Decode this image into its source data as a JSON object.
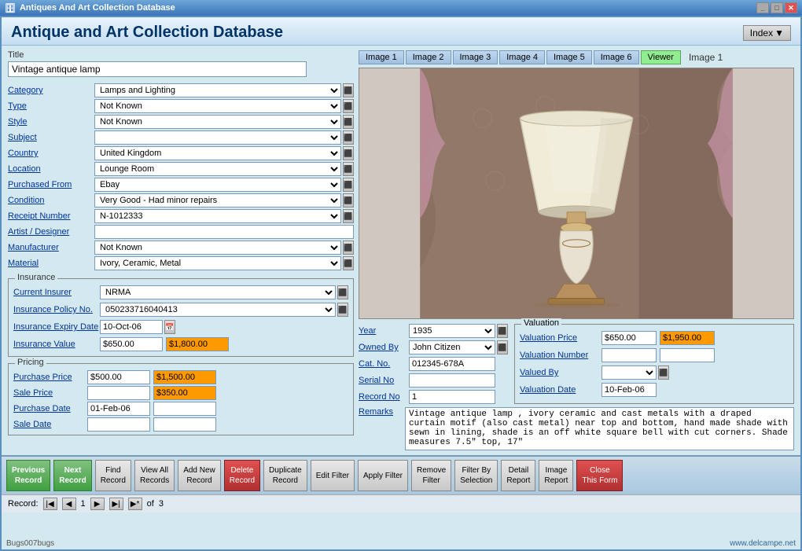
{
  "window": {
    "title": "Antiques And Art Collection Database",
    "app_title": "Antique and Art Collection Database"
  },
  "header": {
    "index_label": "Index",
    "image_label": "Image 1"
  },
  "image_tabs": [
    {
      "id": "img1",
      "label": "Image 1"
    },
    {
      "id": "img2",
      "label": "Image 2"
    },
    {
      "id": "img3",
      "label": "Image 3"
    },
    {
      "id": "img4",
      "label": "Image 4"
    },
    {
      "id": "img5",
      "label": "Image 5"
    },
    {
      "id": "img6",
      "label": "Image 6"
    },
    {
      "id": "viewer",
      "label": "Viewer"
    }
  ],
  "form": {
    "title_label": "Title",
    "title_value": "Vintage antique lamp",
    "fields": [
      {
        "label": "Category",
        "value": "Lamps and Lighting",
        "type": "select"
      },
      {
        "label": "Type",
        "value": "Not Known",
        "type": "select"
      },
      {
        "label": "Style",
        "value": "Not Known",
        "type": "select"
      },
      {
        "label": "Subject",
        "value": "",
        "type": "select"
      },
      {
        "label": "Country",
        "value": "United Kingdom",
        "type": "select"
      },
      {
        "label": "Location",
        "value": "Lounge Room",
        "type": "select"
      },
      {
        "label": "Purchased From",
        "value": "Ebay",
        "type": "select"
      },
      {
        "label": "Condition",
        "value": "Very Good - Had minor repairs",
        "type": "select"
      },
      {
        "label": "Receipt Number",
        "value": "N-1012333",
        "type": "select"
      },
      {
        "label": "Artist / Designer",
        "value": "",
        "type": "text"
      },
      {
        "label": "Manufacturer",
        "value": "Not Known",
        "type": "select"
      },
      {
        "label": "Material",
        "value": "Ivory, Ceramic, Metal",
        "type": "select"
      }
    ]
  },
  "insurance": {
    "section_label": "Insurance",
    "fields": [
      {
        "label": "Current Insurer",
        "value": "NRMA",
        "type": "select"
      },
      {
        "label": "Insurance Policy No.",
        "value": "050233716040413",
        "type": "select"
      },
      {
        "label": "Insurance Expiry Date",
        "value": "10-Oct-06",
        "type": "date"
      },
      {
        "label": "Insurance Value",
        "value1": "$650.00",
        "value2": "$1,800.00",
        "value2_style": "orange"
      }
    ]
  },
  "pricing": {
    "section_label": "Pricing",
    "fields": [
      {
        "label": "Purchase Price",
        "value1": "$500.00",
        "value2": "$1,500.00",
        "value2_style": "orange"
      },
      {
        "label": "Sale Price",
        "value1": "",
        "value2": "$350.00",
        "value2_style": "orange"
      },
      {
        "label": "Purchase Date",
        "value1": "01-Feb-06",
        "value2": ""
      },
      {
        "label": "Sale Date",
        "value1": "",
        "value2": ""
      }
    ]
  },
  "middle_fields": {
    "year_label": "Year",
    "year_value": "1935",
    "owned_by_label": "Owned By",
    "owned_by_value": "John Citizen",
    "cat_no_label": "Cat. No.",
    "cat_no_value": "012345-678A",
    "serial_no_label": "Serial No",
    "serial_no_value": "",
    "record_no_label": "Record No",
    "record_no_value": "1"
  },
  "valuation": {
    "section_label": "Valuation",
    "fields": [
      {
        "label": "Valuation Price",
        "value1": "$650.00",
        "value2": "$1,950.00",
        "value2_style": "orange"
      },
      {
        "label": "Valuation Number",
        "value1": "",
        "value2": ""
      },
      {
        "label": "Valued By",
        "value1": "",
        "type": "select"
      },
      {
        "label": "Valuation Date",
        "value1": "10-Feb-06"
      }
    ]
  },
  "remarks": {
    "label": "Remarks",
    "value": "Vintage antique lamp , ivory ceramic and cast metals with a draped curtain motif (also cast metal) near top and bottom, hand made shade with sewn in lining, shade is an off white square bell with cut corners. Shade measures 7.5\" top, 17\""
  },
  "buttons": [
    {
      "id": "prev-record",
      "label": "Previous\nRecord",
      "style": "nav"
    },
    {
      "id": "next-record",
      "label": "Next\nRecord",
      "style": "nav"
    },
    {
      "id": "find-record",
      "label": "Find\nRecord",
      "style": "action"
    },
    {
      "id": "view-all-records",
      "label": "View All\nRecords",
      "style": "action"
    },
    {
      "id": "add-new-record",
      "label": "Add New\nRecord",
      "style": "action"
    },
    {
      "id": "delete-record",
      "label": "Delete\nRecord",
      "style": "delete"
    },
    {
      "id": "duplicate-record",
      "label": "Duplicate\nRecord",
      "style": "action"
    },
    {
      "id": "edit-filter",
      "label": "Edit Filter",
      "style": "action"
    },
    {
      "id": "apply-filter",
      "label": "Apply Filter",
      "style": "action"
    },
    {
      "id": "remove-filter",
      "label": "Remove\nFilter",
      "style": "action"
    },
    {
      "id": "filter-by-selection",
      "label": "Filter By\nSelection",
      "style": "action"
    },
    {
      "id": "detail-report",
      "label": "Detail\nReport",
      "style": "action"
    },
    {
      "id": "image-report",
      "label": "Image\nReport",
      "style": "action"
    },
    {
      "id": "close-this-form",
      "label": "Close\nThis Form",
      "style": "close"
    }
  ],
  "record_nav": {
    "record_label": "Record:",
    "current": "1",
    "total": "3"
  }
}
